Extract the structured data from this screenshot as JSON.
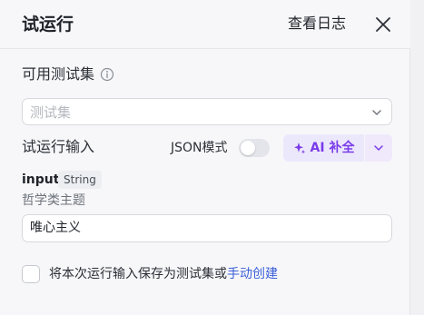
{
  "header": {
    "title": "试运行",
    "view_log": "查看日志"
  },
  "testset": {
    "label": "可用测试集",
    "placeholder": "测试集"
  },
  "run_input": {
    "label": "试运行输入",
    "json_mode_label": "JSON模式",
    "json_mode_on": false,
    "ai_button_label": "AI 补全"
  },
  "field": {
    "name": "input",
    "type": "String",
    "description": "哲学类主题",
    "value": "唯心主义"
  },
  "save": {
    "text": "将本次运行输入保存为测试集或",
    "link": "手动创建",
    "checked": false
  },
  "colors": {
    "accent_purple": "#7a3bea",
    "ai_bg": "#ece8fb",
    "link_blue": "#3a5fd9"
  }
}
